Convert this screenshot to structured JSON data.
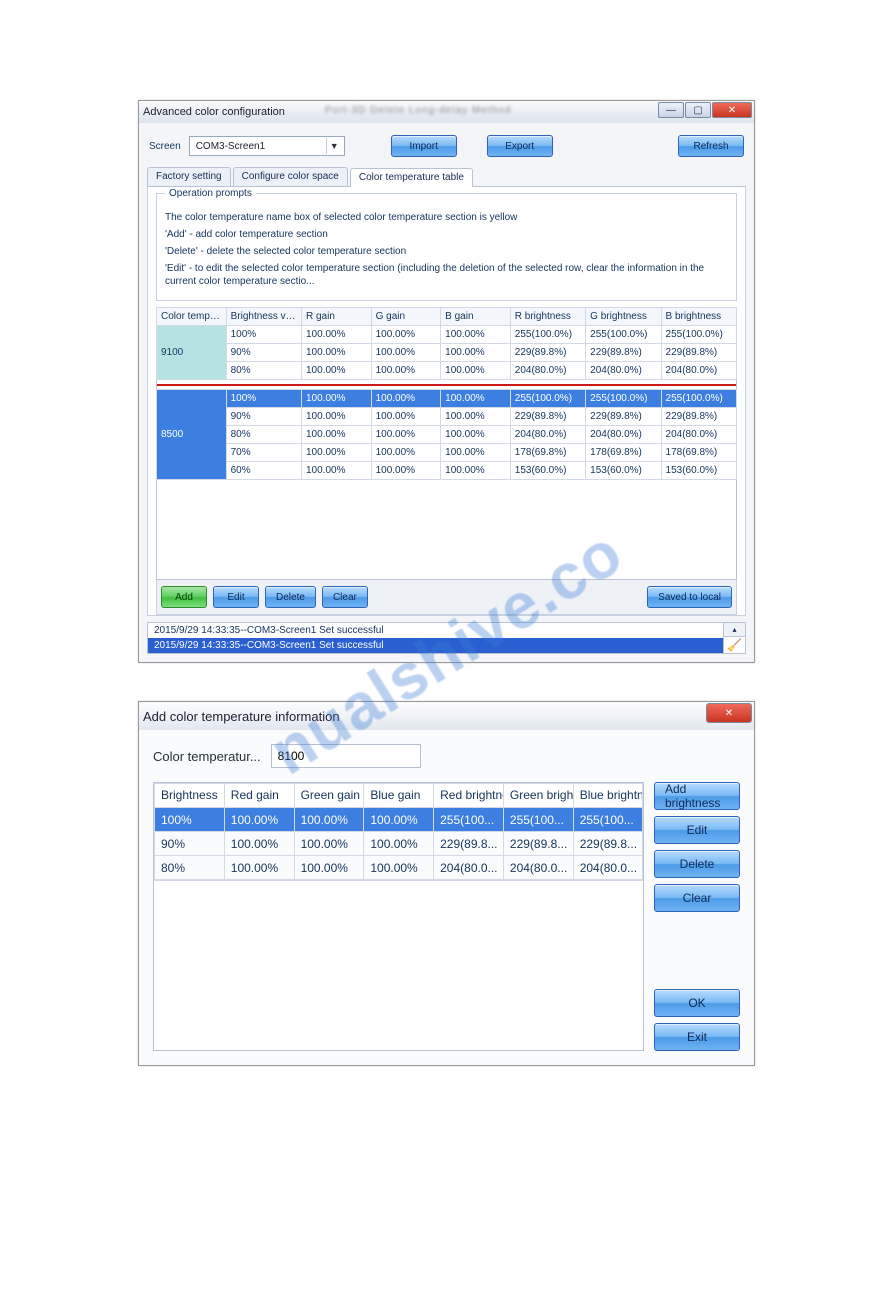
{
  "window1": {
    "title": "Advanced color configuration",
    "blur_labels": "Port-3D   Delete   Long-delay   Method",
    "controls": {
      "screen_label": "Screen",
      "screen_value": "COM3-Screen1",
      "import": "Import",
      "export": "Export",
      "refresh": "Refresh"
    },
    "tabs": {
      "t1": "Factory setting",
      "t2": "Configure color space",
      "t3": "Color temperature table"
    },
    "fieldset": {
      "legend": "Operation prompts",
      "l1": "The color temperature name box of selected color temperature section is yellow",
      "l2": "'Add' - add color temperature section",
      "l3": "'Delete' - delete the selected color temperature section",
      "l4": "'Edit' - to edit the selected color temperature section (including the deletion of the selected row, clear the information in the current color temperature sectio..."
    },
    "columns": {
      "c0": "Color temperature",
      "c1": "Brightness value",
      "c2": "R gain",
      "c3": "G gain",
      "c4": "B gain",
      "c5": "R brightness",
      "c6": "G brightness",
      "c7": "B brightness"
    },
    "sections": [
      {
        "ct": "9100",
        "ct_class": "c9100",
        "rows": [
          [
            "100%",
            "100.00%",
            "100.00%",
            "100.00%",
            "255(100.0%)",
            "255(100.0%)",
            "255(100.0%)"
          ],
          [
            "90%",
            "100.00%",
            "100.00%",
            "100.00%",
            "229(89.8%)",
            "229(89.8%)",
            "229(89.8%)"
          ],
          [
            "80%",
            "100.00%",
            "100.00%",
            "100.00%",
            "204(80.0%)",
            "204(80.0%)",
            "204(80.0%)"
          ]
        ],
        "selected_row": null
      },
      {
        "ct": "8500",
        "ct_class": "c8500",
        "rows": [
          [
            "100%",
            "100.00%",
            "100.00%",
            "100.00%",
            "255(100.0%)",
            "255(100.0%)",
            "255(100.0%)"
          ],
          [
            "90%",
            "100.00%",
            "100.00%",
            "100.00%",
            "229(89.8%)",
            "229(89.8%)",
            "229(89.8%)"
          ],
          [
            "80%",
            "100.00%",
            "100.00%",
            "100.00%",
            "204(80.0%)",
            "204(80.0%)",
            "204(80.0%)"
          ],
          [
            "70%",
            "100.00%",
            "100.00%",
            "100.00%",
            "178(69.8%)",
            "178(69.8%)",
            "178(69.8%)"
          ],
          [
            "60%",
            "100.00%",
            "100.00%",
            "100.00%",
            "153(60.0%)",
            "153(60.0%)",
            "153(60.0%)"
          ]
        ],
        "selected_row": 0
      }
    ],
    "actions": {
      "add": "Add",
      "edit": "Edit",
      "delete": "Delete",
      "clear": "Clear",
      "save": "Saved to local"
    },
    "log": {
      "l1": "2015/9/29 14:33:35--COM3-Screen1 Set successful",
      "l2": "2015/9/29 14:33:35--COM3-Screen1 Set successful"
    }
  },
  "window2": {
    "title": "Add color temperature information",
    "ct_label": "Color temperatur...",
    "ct_value": "8100",
    "columns": {
      "c0": "Brightness",
      "c1": "Red gain",
      "c2": "Green gain",
      "c3": "Blue gain",
      "c4": "Red brightness",
      "c5": "Green brightness",
      "c6": "Blue brightness"
    },
    "rows": [
      [
        "100%",
        "100.00%",
        "100.00%",
        "100.00%",
        "255(100...",
        "255(100...",
        "255(100..."
      ],
      [
        "90%",
        "100.00%",
        "100.00%",
        "100.00%",
        "229(89.8...",
        "229(89.8...",
        "229(89.8..."
      ],
      [
        "80%",
        "100.00%",
        "100.00%",
        "100.00%",
        "204(80.0...",
        "204(80.0...",
        "204(80.0..."
      ]
    ],
    "selected_row": 0,
    "buttons": {
      "add": "Add brightness",
      "edit": "Edit",
      "delete": "Delete",
      "clear": "Clear",
      "ok": "OK",
      "exit": "Exit"
    }
  },
  "watermark": "nualshive.co"
}
